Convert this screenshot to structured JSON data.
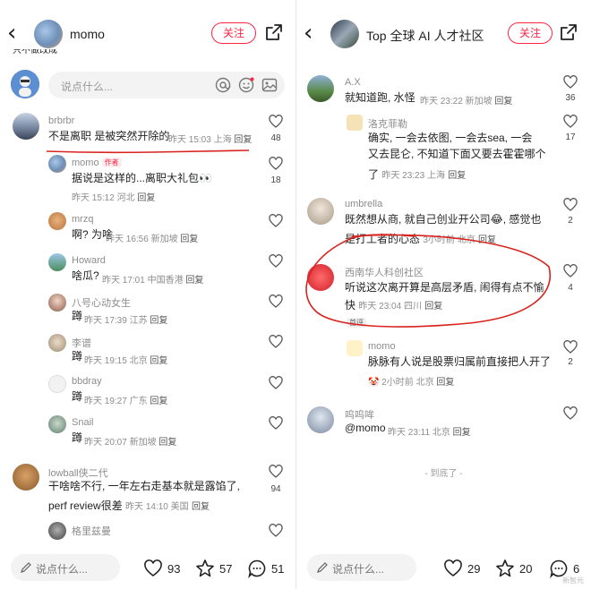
{
  "left": {
    "header": {
      "title": "momo",
      "follow_label": "关注"
    },
    "top_clip_text": "只不做改成",
    "input_placeholder": "说点什么...",
    "comments": [
      {
        "author": "brbrbr",
        "text": "不是离职 是被突然开除的",
        "time": "昨天 15:03 上海",
        "reply": "回复",
        "likes": "48"
      },
      {
        "author": "momo",
        "tag": "作者",
        "text": "据说是这样的...离职大礼包👀",
        "time": "昨天 15:12 河北",
        "reply": "回复",
        "likes": "18"
      },
      {
        "author": "mrzq",
        "text": "啊? 为啥",
        "time": "昨天 16:56 新加坡",
        "reply": "回复",
        "likes": ""
      },
      {
        "author": "Howard",
        "text": "啥瓜?",
        "time": "昨天 17:01 中国香港",
        "reply": "回复",
        "likes": ""
      },
      {
        "author": "八号心动女生",
        "text": "蹲",
        "time": "昨天 17:39 江苏",
        "reply": "回复",
        "likes": ""
      },
      {
        "author": "李谱",
        "text": "蹲",
        "time": "昨天 19:15 北京",
        "reply": "回复",
        "likes": ""
      },
      {
        "author": "bbdray",
        "text": "蹲",
        "time": "昨天 19:27 广东",
        "reply": "回复",
        "likes": ""
      },
      {
        "author": "Snail",
        "text": "蹲",
        "time": "昨天 20:07 新加坡",
        "reply": "回复",
        "likes": ""
      },
      {
        "author": "lowball侠二代",
        "text_line1": "干啥啥不行, 一年左右走基本就是露馅了,",
        "text_line2": "perf review很差",
        "time": "昨天 14:10 美国",
        "reply": "回复",
        "likes": "94"
      },
      {
        "author": "格里兹曼",
        "text": "",
        "time": "",
        "reply": "",
        "likes": ""
      }
    ],
    "bottom": {
      "placeholder": "说点什么...",
      "likes": "93",
      "stars": "57",
      "comments": "51"
    }
  },
  "right": {
    "header": {
      "title": "Top 全球 AI 人才社区",
      "follow_label": "关注"
    },
    "comments": [
      {
        "author": "A.X",
        "text": "就知道跑, 水怪",
        "time": "昨天 23:22 新加坡",
        "reply": "回复",
        "likes": "36"
      },
      {
        "author": "洛克菲勒",
        "text_line1": "确实, 一会去依图, 一会去sea, 一会",
        "text_line2": "又去昆仑, 不知道下面又要去霍霍哪个",
        "text_line3": "了",
        "time": "昨天 23:23 上海",
        "reply": "回复",
        "likes": "17"
      },
      {
        "author": "umbrella",
        "text_line1": "既然想从商, 就自己创业开公司😂, 感觉也",
        "text_line2": "是打工者的心态",
        "time": "3小时前 北京",
        "reply": "回复",
        "likes": "2"
      },
      {
        "author": "西南华人科创社区",
        "text_line1": "听说这次离开算是高层矛盾, 闹得有点不愉",
        "text_line2": "快",
        "time": "昨天 23:04 四川",
        "reply": "回复",
        "likes": "4",
        "badge": "首评"
      },
      {
        "author": "momo",
        "text": "脉脉有人说是股票归属前直接把人开了",
        "time": "2小时前 北京",
        "reply": "回复",
        "likes": "2"
      },
      {
        "author": "呜呜哞",
        "text": "@momo",
        "time": "昨天 23:11 北京",
        "reply": "回复",
        "likes": ""
      }
    ],
    "end_text": "- 到底了 -",
    "bottom": {
      "placeholder": "说点什么...",
      "likes": "29",
      "stars": "20",
      "comments": "6"
    }
  },
  "watermark": "新智元",
  "colors": {
    "accent": "#ff2442",
    "annotation_red": "#d8231e",
    "muted": "#8c8c8c"
  }
}
